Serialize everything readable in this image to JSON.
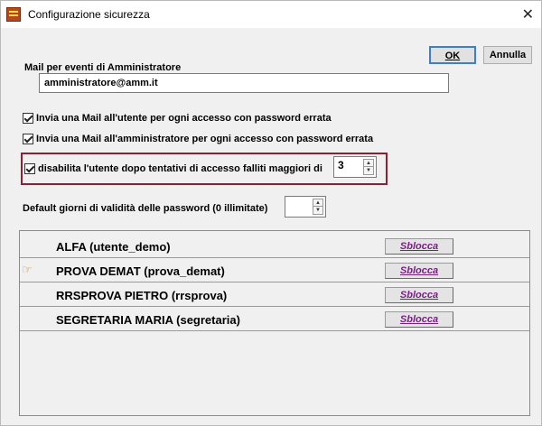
{
  "window": {
    "title": "Configurazione sicurezza",
    "close_glyph": "✕",
    "icon": "app-icon"
  },
  "buttons": {
    "ok_label": "OK",
    "cancel_label": "Annulla"
  },
  "admin_mail": {
    "label": "Mail per eventi di Amministratore",
    "value": "amministratore@amm.it"
  },
  "options": {
    "mail_user": {
      "label": "Invia una Mail all'utente per ogni accesso con password errata",
      "checked": true
    },
    "mail_admin": {
      "label": "Invia una Mail all'amministratore per ogni accesso con password errata",
      "checked": true
    },
    "disable_user": {
      "label": "disabilita l'utente dopo tentativi di accesso falliti maggiori di",
      "checked": true,
      "attempts_value": "3"
    }
  },
  "password_validity": {
    "label": "Default giorni di validità delle password (0 illimitate)",
    "value": ""
  },
  "users": [
    {
      "name": "ALFA (utente_demo)",
      "action": "Sblocca"
    },
    {
      "name": "PROVA DEMAT (prova_demat)",
      "action": "Sblocca",
      "selected": true
    },
    {
      "name": "RRSPROVA PIETRO (rrsprova)",
      "action": "Sblocca"
    },
    {
      "name": "SEGRETARIA MARIA (segretaria)",
      "action": "Sblocca"
    }
  ],
  "colors": {
    "highlight_border": "#8b2233",
    "link_color": "#7b1e86",
    "ok_focus": "#3c7fd1"
  }
}
